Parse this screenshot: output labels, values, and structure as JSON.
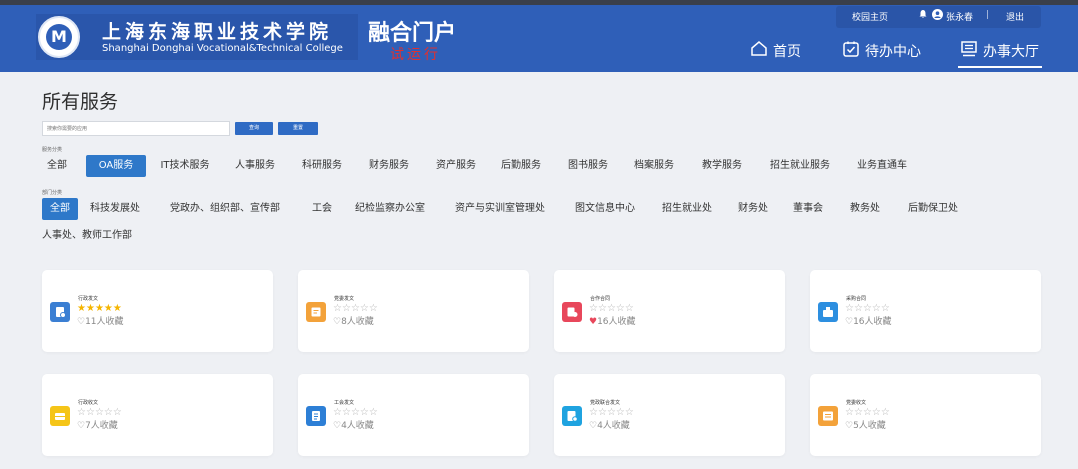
{
  "header": {
    "school_cn": "上海东海职业技术学院",
    "school_en": "Shanghai Donghai Vocational&Technical College",
    "portal_title": "融合门户",
    "trial_text": "试运行",
    "campus_home": "校园主页",
    "user_name": "张永春",
    "separator": "|",
    "logout": "退出",
    "nav": {
      "home": "首页",
      "todo": "待办中心",
      "service_hall": "办事大厅"
    }
  },
  "page": {
    "title": "所有服务",
    "search_placeholder": "搜索你需要的应用",
    "search_btn": "查询",
    "reset_btn": "重置",
    "service_category_label": "服务分类",
    "department_category_label": "部门分类"
  },
  "service_categories": [
    "全部",
    "OA服务",
    "IT技术服务",
    "人事服务",
    "科研服务",
    "财务服务",
    "资产服务",
    "后勤服务",
    "图书服务",
    "档案服务",
    "教学服务",
    "招生就业服务",
    "业务直通车"
  ],
  "selected_service_category": "OA服务",
  "departments": [
    "全部",
    "科技发展处",
    "党政办、组织部、宣传部",
    "工会",
    "纪检监察办公室",
    "资产与实训室管理处",
    "图文信息中心",
    "招生就业处",
    "财务处",
    "董事会",
    "教务处",
    "后勤保卫处",
    "人事处、教师工作部"
  ],
  "selected_department": "全部",
  "cards": [
    {
      "name": "行政发文",
      "rating": 5,
      "favorites": "11人收藏",
      "favorited": false,
      "color": "#3b7fd3",
      "icon": "document-icon"
    },
    {
      "name": "党委发文",
      "rating": 0,
      "favorites": "8人收藏",
      "favorited": false,
      "color": "#f3a23a",
      "icon": "note-icon"
    },
    {
      "name": "合作合同",
      "rating": 0,
      "favorites": "16人收藏",
      "favorited": true,
      "color": "#e8475b",
      "icon": "contract-icon"
    },
    {
      "name": "采购合同",
      "rating": 0,
      "favorites": "16人收藏",
      "favorited": false,
      "color": "#2d8fe0",
      "icon": "purchase-icon"
    },
    {
      "name": "行政收文",
      "rating": 0,
      "favorites": "7人收藏",
      "favorited": false,
      "color": "#f5c518",
      "icon": "inbox-icon"
    },
    {
      "name": "工会发文",
      "rating": 0,
      "favorites": "4人收藏",
      "favorited": false,
      "color": "#2d7fd6",
      "icon": "file-icon"
    },
    {
      "name": "党政联合发文",
      "rating": 0,
      "favorites": "4人收藏",
      "favorited": false,
      "color": "#1fa3e0",
      "icon": "joint-file-icon"
    },
    {
      "name": "党委收文",
      "rating": 0,
      "favorites": "5人收藏",
      "favorited": false,
      "color": "#f3a23a",
      "icon": "receive-icon"
    }
  ],
  "colors": {
    "header_bg": "#2f5fb8",
    "active_tag": "#2e78c9",
    "star_filled": "#f5b500",
    "heart_active": "#e8475b"
  }
}
